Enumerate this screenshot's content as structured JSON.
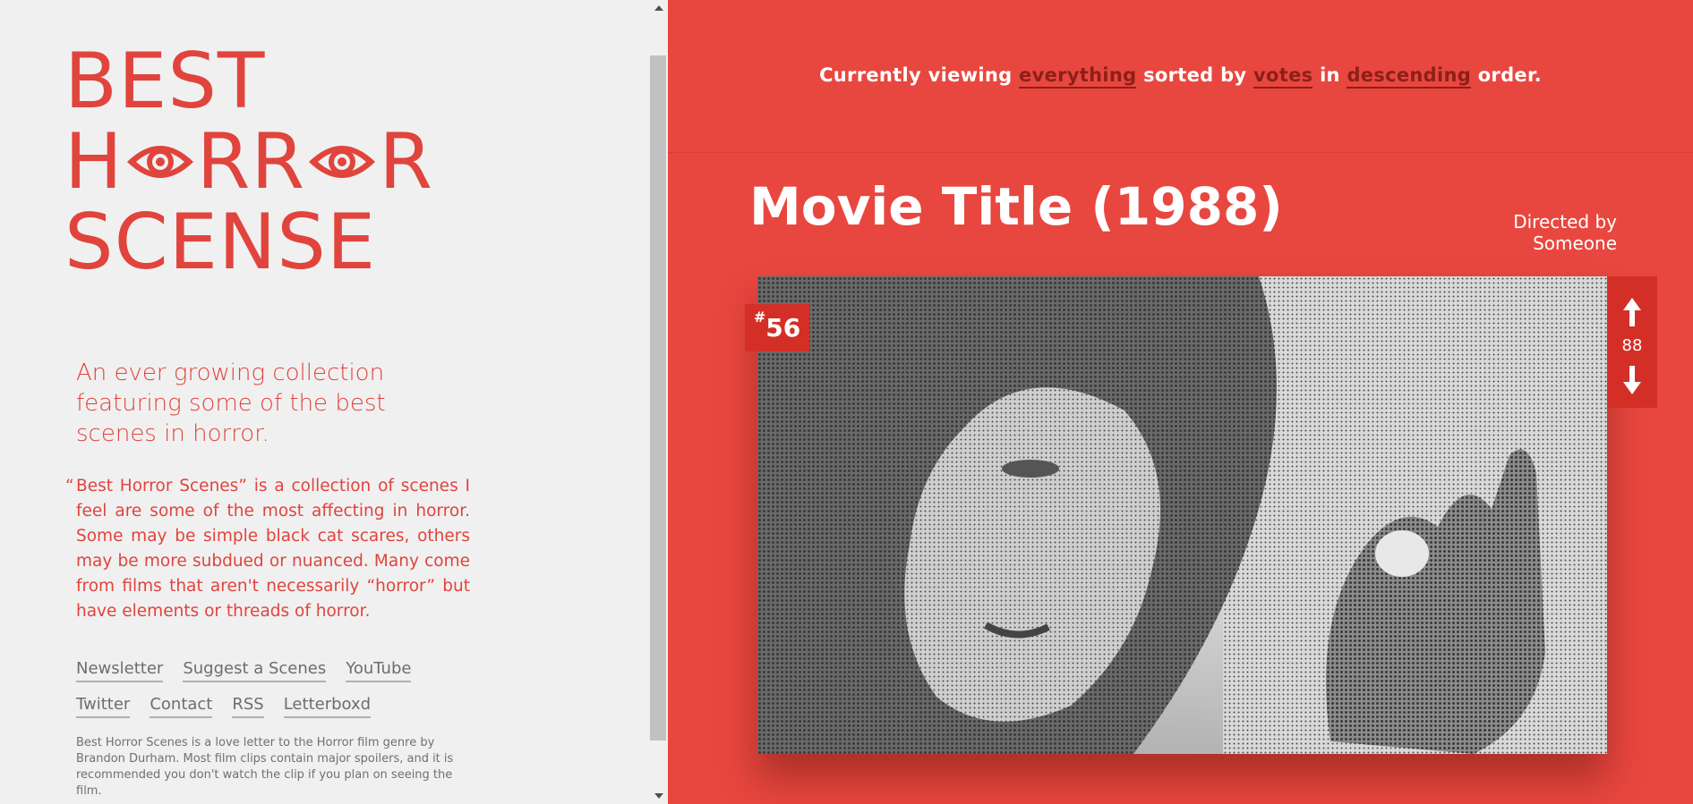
{
  "sidebar": {
    "logo": {
      "line1": "BEST",
      "line2_pre": "H",
      "line2_mid": "RR",
      "line2_post": "R",
      "line3": "SCENSE"
    },
    "tagline": "An ever growing collection featuring some of the best scenes in horror.",
    "about": "Best Horror Scenes” is a collection of scenes I feel are some of the most affecting in horror. Some may be simple black cat scares, others may be more subdued or nuanced. Many come from films that aren't necessarily “horror” but have elements or threads of horror.",
    "links": {
      "newsletter": "Newsletter",
      "suggest": "Suggest a Scenes",
      "youtube": "YouTube",
      "twitter": "Twitter",
      "contact": "Contact",
      "rss": "RSS",
      "letterboxd": "Letterboxd"
    },
    "footnote": "Best Horror Scenes is a love letter to the Horror film genre by Brandon Durham. Most film clips contain major spoilers, and it is recommended you don't watch the clip if you plan on seeing the film."
  },
  "sorting": {
    "prefix": "Currently viewing",
    "filter": "everything",
    "sorted_by_text": "sorted by",
    "sort_field": "votes",
    "in_text": "in",
    "order": "descending",
    "suffix": "order."
  },
  "scene": {
    "title": "Movie Title (1988)",
    "director": "Directed by Someone",
    "rank_hash": "#",
    "rank_number": "56",
    "votes": "88",
    "image": "halftone still of a child with bangs beside a raised hand"
  },
  "colors": {
    "brand_red": "#e8473f",
    "dark_red": "#d32f27",
    "link_dark": "#8c1f19",
    "sidebar_bg": "#f0f0f0"
  },
  "icons": {
    "eye": "eye-icon",
    "upvote": "arrow-up-icon",
    "downvote": "arrow-down-icon"
  }
}
